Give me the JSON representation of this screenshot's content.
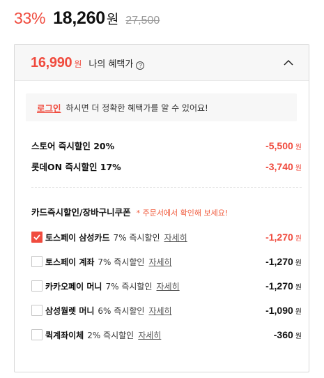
{
  "price": {
    "discount_rate": "33%",
    "sale_price": "18,260",
    "currency": "원",
    "original_price": "27,500"
  },
  "benefit": {
    "price": "16,990",
    "currency": "원",
    "label": "나의 혜택가",
    "help_icon": "question-circle-icon",
    "toggle_icon": "chevron-up-icon"
  },
  "login_prompt": {
    "link_label": "로그인",
    "message": "하시면 더 정확한 혜택가를 알 수 있어요!"
  },
  "instant_discounts": [
    {
      "name": "스토어 즉시할인 20%",
      "amount": "-5,500",
      "currency": "원"
    },
    {
      "name": "롯데ON 즉시할인 17%",
      "amount": "-3,740",
      "currency": "원"
    }
  ],
  "card_coupons": {
    "title": "카드즉시할인/장바구니쿠폰",
    "note": "* 주문서에서 확인해 보세요!",
    "detail_label": "자세히",
    "items": [
      {
        "name": "토스페이 삼성카드",
        "rate": "7% 즉시할인",
        "amount": "-1,270",
        "currency": "원",
        "checked": true
      },
      {
        "name": "토스페이 계좌",
        "rate": "7% 즉시할인",
        "amount": "-1,270",
        "currency": "원",
        "checked": false
      },
      {
        "name": "카카오페이 머니",
        "rate": "7% 즉시할인",
        "amount": "-1,270",
        "currency": "원",
        "checked": false
      },
      {
        "name": "삼성월렛 머니",
        "rate": "6% 즉시할인",
        "amount": "-1,090",
        "currency": "원",
        "checked": false
      },
      {
        "name": "퀵계좌이체",
        "rate": "2% 즉시할인",
        "amount": "-360",
        "currency": "원",
        "checked": false
      }
    ]
  },
  "colors": {
    "accent": "#f04b3e",
    "note": "#f05a3c",
    "panel_header_bg": "#f7f7f7",
    "border": "#d7d7d7"
  }
}
